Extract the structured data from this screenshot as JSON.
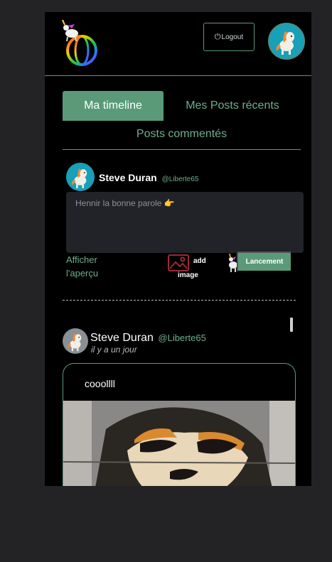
{
  "header": {
    "logo_icon": "unicorn-globe-logo",
    "logout_icon": "power-icon",
    "logout_label": "Logout",
    "avatar_icon": "pony-avatar"
  },
  "tabs": {
    "timeline": "Ma timeline",
    "recent": "Mes Posts récents",
    "commented": "Posts commentés"
  },
  "composer": {
    "name": "Steve Duran",
    "handle": "@Liberte65",
    "placeholder": "Hennir la bonne parole 👉",
    "preview_label": "Afficher l'aperçu",
    "add_image_line1": "add",
    "add_image_line2": "image",
    "launch_label": "Lancement"
  },
  "post": {
    "name": "Steve Duran",
    "handle": "@Liberte65",
    "time": "il y a un jour",
    "text": "cooollll"
  },
  "colors": {
    "accent": "#5a9a79",
    "background": "#000000",
    "page": "#232325"
  }
}
